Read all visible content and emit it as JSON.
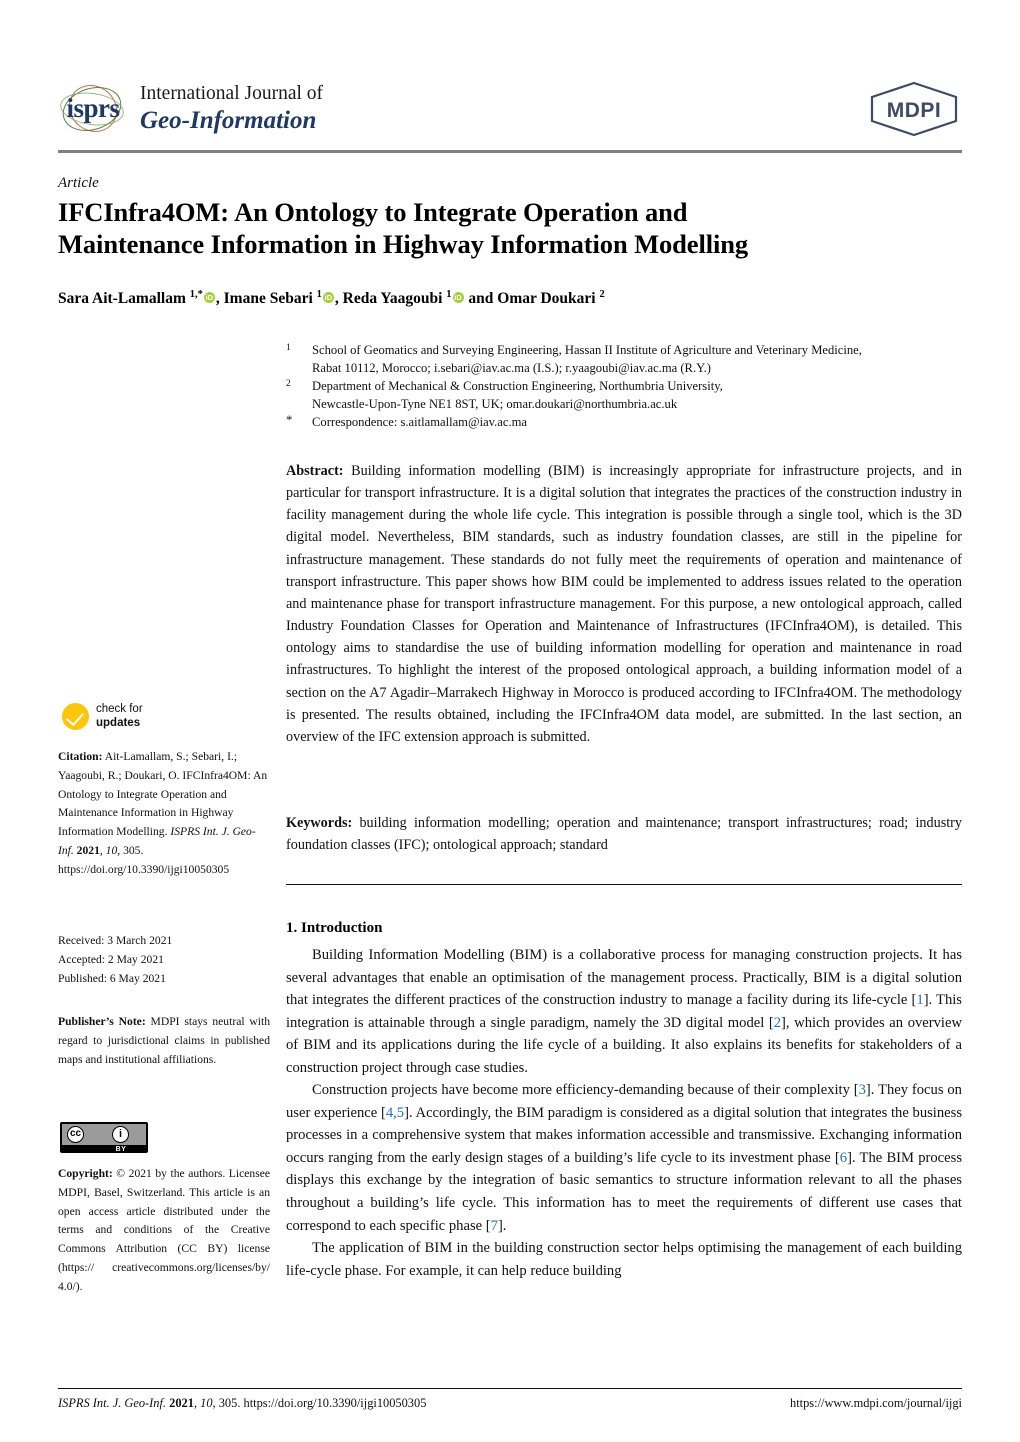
{
  "header": {
    "journal_line1": "International Journal of",
    "journal_line2": "Geo-Information",
    "isprs_wordmark": "isprs",
    "publisher_logo_text": "MDPI"
  },
  "article": {
    "kicker": "Article",
    "title_line1": "IFCInfra4OM: An Ontology to Integrate Operation and",
    "title_line2": "Maintenance Information in Highway Information Modelling"
  },
  "authors": {
    "list_prefix": "Sara Ait-Lamallam ",
    "a1_sup": "1,*",
    "sep1": ", Imane Sebari ",
    "a2_sup": "1",
    "sep2": ", Reda Yaagoubi ",
    "a3_sup": "1",
    "sep3": " and Omar Doukari ",
    "a4_sup": "2",
    "orcid_label": "iD"
  },
  "affiliations": [
    {
      "marker": "1",
      "lines": [
        "School of Geomatics and Surveying Engineering, Hassan II Institute of Agriculture and Veterinary Medicine,",
        "Rabat 10112, Morocco; i.sebari@iav.ac.ma (I.S.); r.yaagoubi@iav.ac.ma (R.Y.)"
      ]
    },
    {
      "marker": "2",
      "lines": [
        "Department of Mechanical & Construction Engineering, Northumbria University,",
        "Newcastle-Upon-Tyne NE1 8ST, UK; omar.doukari@northumbria.ac.uk"
      ]
    },
    {
      "marker": "*",
      "lines": [
        "Correspondence: s.aitlamallam@iav.ac.ma"
      ]
    }
  ],
  "abstract": {
    "label": "Abstract:",
    "text": " Building information modelling (BIM) is increasingly appropriate for infrastructure projects, and in particular for transport infrastructure. It is a digital solution that integrates the practices of the construction industry in facility management during the whole life cycle. This integration is possible through a single tool, which is the 3D digital model. Nevertheless, BIM standards, such as industry foundation classes, are still in the pipeline for infrastructure management. These standards do not fully meet the requirements of operation and maintenance of transport infrastructure. This paper shows how BIM could be implemented to address issues related to the operation and maintenance phase for transport infrastructure management. For this purpose, a new ontological approach, called Industry Foundation Classes for Operation and Maintenance of Infrastructures (IFCInfra4OM), is detailed. This ontology aims to standardise the use of building information modelling for operation and maintenance in road infrastructures. To highlight the interest of the proposed ontological approach, a building information model of a section on the A7 Agadir–Marrakech Highway in Morocco is produced according to IFCInfra4OM. The methodology is presented. The results obtained, including the IFCInfra4OM data model, are submitted. In the last section, an overview of the IFC extension approach is submitted."
  },
  "keywords": {
    "label": "Keywords:",
    "text": " building information modelling; operation and maintenance; transport infrastructures; road; industry foundation classes (IFC); ontological approach; standard"
  },
  "introduction": {
    "heading": "1. Introduction",
    "paragraphs": [
      {
        "parts": [
          {
            "t": "Building Information Modelling (BIM) is a collaborative process for managing construction projects. It has several advantages that enable an optimisation of the management process. Practically, BIM is a digital solution that integrates the different practices of the construction industry to manage a facility during its life-cycle ["
          },
          {
            "t": "1",
            "cite": true
          },
          {
            "t": "]. This integration is attainable through a single paradigm, namely the 3D digital model ["
          },
          {
            "t": "2",
            "cite": true
          },
          {
            "t": "], which provides an overview of BIM and its applications during the life cycle of a building. It also explains its benefits for stakeholders of a construction project through case studies."
          }
        ]
      },
      {
        "parts": [
          {
            "t": "Construction projects have become more efficiency-demanding because of their complexity ["
          },
          {
            "t": "3",
            "cite": true
          },
          {
            "t": "]. They focus on user experience ["
          },
          {
            "t": "4,5",
            "cite": true
          },
          {
            "t": "]. Accordingly, the BIM paradigm is considered as a digital solution that integrates the business processes in a comprehensive system that makes information accessible and transmissive. Exchanging information occurs ranging from the early design stages of a building’s life cycle to its investment phase ["
          },
          {
            "t": "6",
            "cite": true
          },
          {
            "t": "]. The BIM process displays this exchange by the integration of basic semantics to structure information relevant to all the phases throughout a building’s life cycle. This information has to meet the requirements of different use cases that correspond to each specific phase ["
          },
          {
            "t": "7",
            "cite": true
          },
          {
            "t": "]."
          }
        ]
      },
      {
        "parts": [
          {
            "t": "The application of BIM in the building construction sector helps optimising the management of each building life-cycle phase. For example, it can help reduce building"
          }
        ]
      }
    ]
  },
  "sidebar": {
    "check_updates": {
      "line1": "check for",
      "line2": "updates"
    },
    "citation": {
      "label": "Citation:",
      "authors": " Ait-Lamallam, S.; Sebari, I.; Yaagoubi, R.; Doukari, O. IFCInfra4OM: An Ontology to Integrate Operation and Maintenance Information in Highway Information Modelling. ",
      "journal_italic": "ISPRS Int. J. Geo-Inf.",
      "year": " 2021",
      "volume_italic": ", 10",
      "pages": ", 305. ",
      "doi": "https://doi.org/10.3390/ijgi10050305"
    },
    "dates": {
      "received": "Received: 3 March 2021",
      "accepted": "Accepted: 2 May 2021",
      "published": "Published: 6 May 2021"
    },
    "publisher_note": {
      "label": "Publisher’s Note:",
      "text": " MDPI stays neutral with regard to jurisdictional claims in published maps and institutional affiliations."
    },
    "cc_badge": {
      "cc_glyph": "cc",
      "by_glyph": "i",
      "by_label": "BY"
    },
    "copyright": {
      "label": "Copyright:",
      "text": " © 2021 by the authors. Licensee MDPI, Basel, Switzerland. This article is an open access article distributed under the terms and conditions of the Creative Commons Attribution (CC BY) license (https:// creativecommons.org/licenses/by/ 4.0/)."
    }
  },
  "footer": {
    "left_journal_italic": "ISPRS Int. J. Geo-Inf.",
    "left_year": " 2021",
    "left_volume_italic": ", 10",
    "left_rest": ", 305. https://doi.org/10.3390/ijgi10050305",
    "right_url": "https://www.mdpi.com/journal/ijgi"
  },
  "colors": {
    "journal_blue": "#1f3864",
    "citation_link": "#1a73c8",
    "orcid_green": "#a6ce39",
    "check_yellow": "#fdc60b",
    "rule_gray": "#808080"
  }
}
